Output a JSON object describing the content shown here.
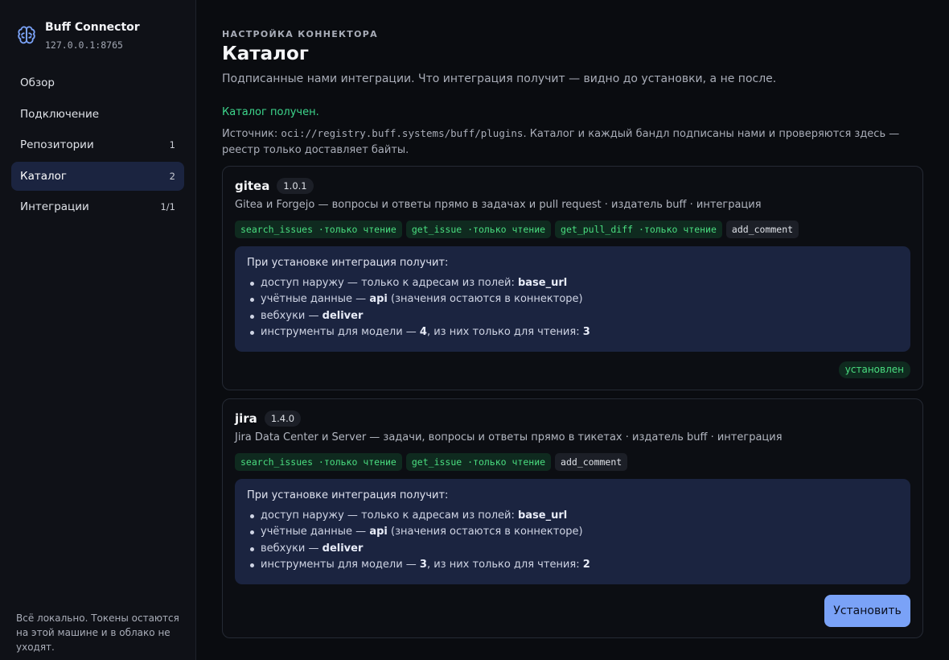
{
  "sidebar": {
    "brand": {
      "title": "Buff Connector",
      "address": "127.0.0.1:8765",
      "icon": "brain-icon"
    },
    "items": [
      {
        "label": "Обзор",
        "count": ""
      },
      {
        "label": "Подключение",
        "count": ""
      },
      {
        "label": "Репозитории",
        "count": "1"
      },
      {
        "label": "Каталог",
        "count": "2",
        "active": true
      },
      {
        "label": "Интеграции",
        "count": "1/1"
      }
    ],
    "footer": "Всё локально. Токены остаются на этой машине и в облако не уходят."
  },
  "main": {
    "eyebrow": "НАСТРОЙКА КОННЕКТОРА",
    "title": "Каталог",
    "subtitle": "Подписанные нами интеграции. Что интеграция получит — видно до установки, а не после.",
    "status": "Каталог получен.",
    "source_prefix": "Источник: ",
    "source_url": "oci://registry.buff.systems/buff/plugins",
    "source_suffix": ". Каталог и каждый бандл подписаны нами и проверяются здесь — реестр только доставляет байты."
  },
  "cards": [
    {
      "name": "gitea",
      "version": "1.0.1",
      "description": "Gitea и Forgejo — вопросы и ответы прямо в задачах и pull request · издатель buff · интеграция",
      "tools": [
        {
          "label": "search_issues ·только чтение",
          "readonly": true
        },
        {
          "label": "get_issue ·только чтение",
          "readonly": true
        },
        {
          "label": "get_pull_diff ·только чтение",
          "readonly": true
        },
        {
          "label": "add_comment",
          "readonly": false
        }
      ],
      "perm_title": "При установке интеграция получит:",
      "perms": {
        "net_prefix": "доступ наружу — только к адресам из полей: ",
        "net_value": "base_url",
        "cred_prefix": "учётные данные — ",
        "cred_value": "api",
        "cred_suffix": " (значения остаются в коннекторе)",
        "hooks_prefix": "вебхуки — ",
        "hooks_value": "deliver",
        "tools_prefix": "инструменты для модели — ",
        "tools_total": "4",
        "tools_mid": ", из них только для чтения: ",
        "tools_ro": "3"
      },
      "status_badge": "установлен"
    },
    {
      "name": "jira",
      "version": "1.4.0",
      "description": "Jira Data Center и Server — задачи, вопросы и ответы прямо в тикетах · издатель buff · интеграция",
      "tools": [
        {
          "label": "search_issues ·только чтение",
          "readonly": true
        },
        {
          "label": "get_issue ·только чтение",
          "readonly": true
        },
        {
          "label": "add_comment",
          "readonly": false
        }
      ],
      "perm_title": "При установке интеграция получит:",
      "perms": {
        "net_prefix": "доступ наружу — только к адресам из полей: ",
        "net_value": "base_url",
        "cred_prefix": "учётные данные — ",
        "cred_value": "api",
        "cred_suffix": " (значения остаются в коннекторе)",
        "hooks_prefix": "вебхуки — ",
        "hooks_value": "deliver",
        "tools_prefix": "инструменты для модели — ",
        "tools_total": "3",
        "tools_mid": ", из них только для чтения: ",
        "tools_ro": "2"
      },
      "install_label": "Установить"
    }
  ],
  "colors": {
    "accent": "#7aa2f7",
    "success": "#4ade80",
    "panel": "#1b2440"
  }
}
